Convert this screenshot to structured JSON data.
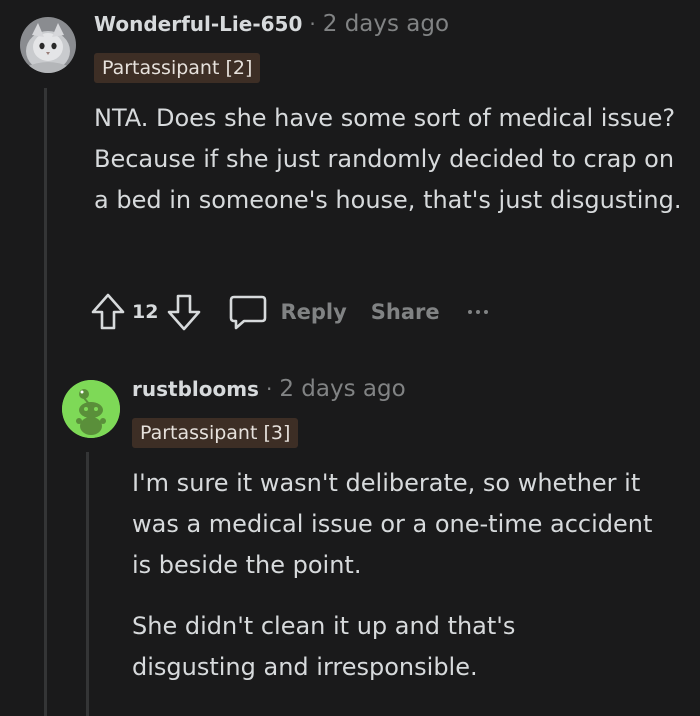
{
  "comments": [
    {
      "username": "Wonderful-Lie-650",
      "separator": "·",
      "timestamp": "2 days ago",
      "flair": "Partassipant [2]",
      "avatar_icon": "cat-avatar-icon",
      "paragraphs": [
        "NTA. Does she have some sort of medical issue? Because if she just randomly decided to crap on a bed in someone's house, that's just disgusting."
      ],
      "actions": {
        "vote_count": "12",
        "reply_label": "Reply",
        "share_label": "Share"
      }
    },
    {
      "username": "rustblooms",
      "separator": "·",
      "timestamp": "2 days ago",
      "flair": "Partassipant [3]",
      "avatar_icon": "snoo-avatar-icon",
      "paragraphs": [
        "I'm sure it wasn't deliberate, so whether it was a medical issue or a one-time accident is beside the point.",
        "She didn't clean it up and that's disgusting and irresponsible."
      ]
    }
  ],
  "colors": {
    "background": "#1a1a1b",
    "text": "#d7dadc",
    "muted": "#818384",
    "flair_bg": "#3d2e25",
    "snoo_bg": "#7ed957",
    "thread_line": "#343536"
  }
}
